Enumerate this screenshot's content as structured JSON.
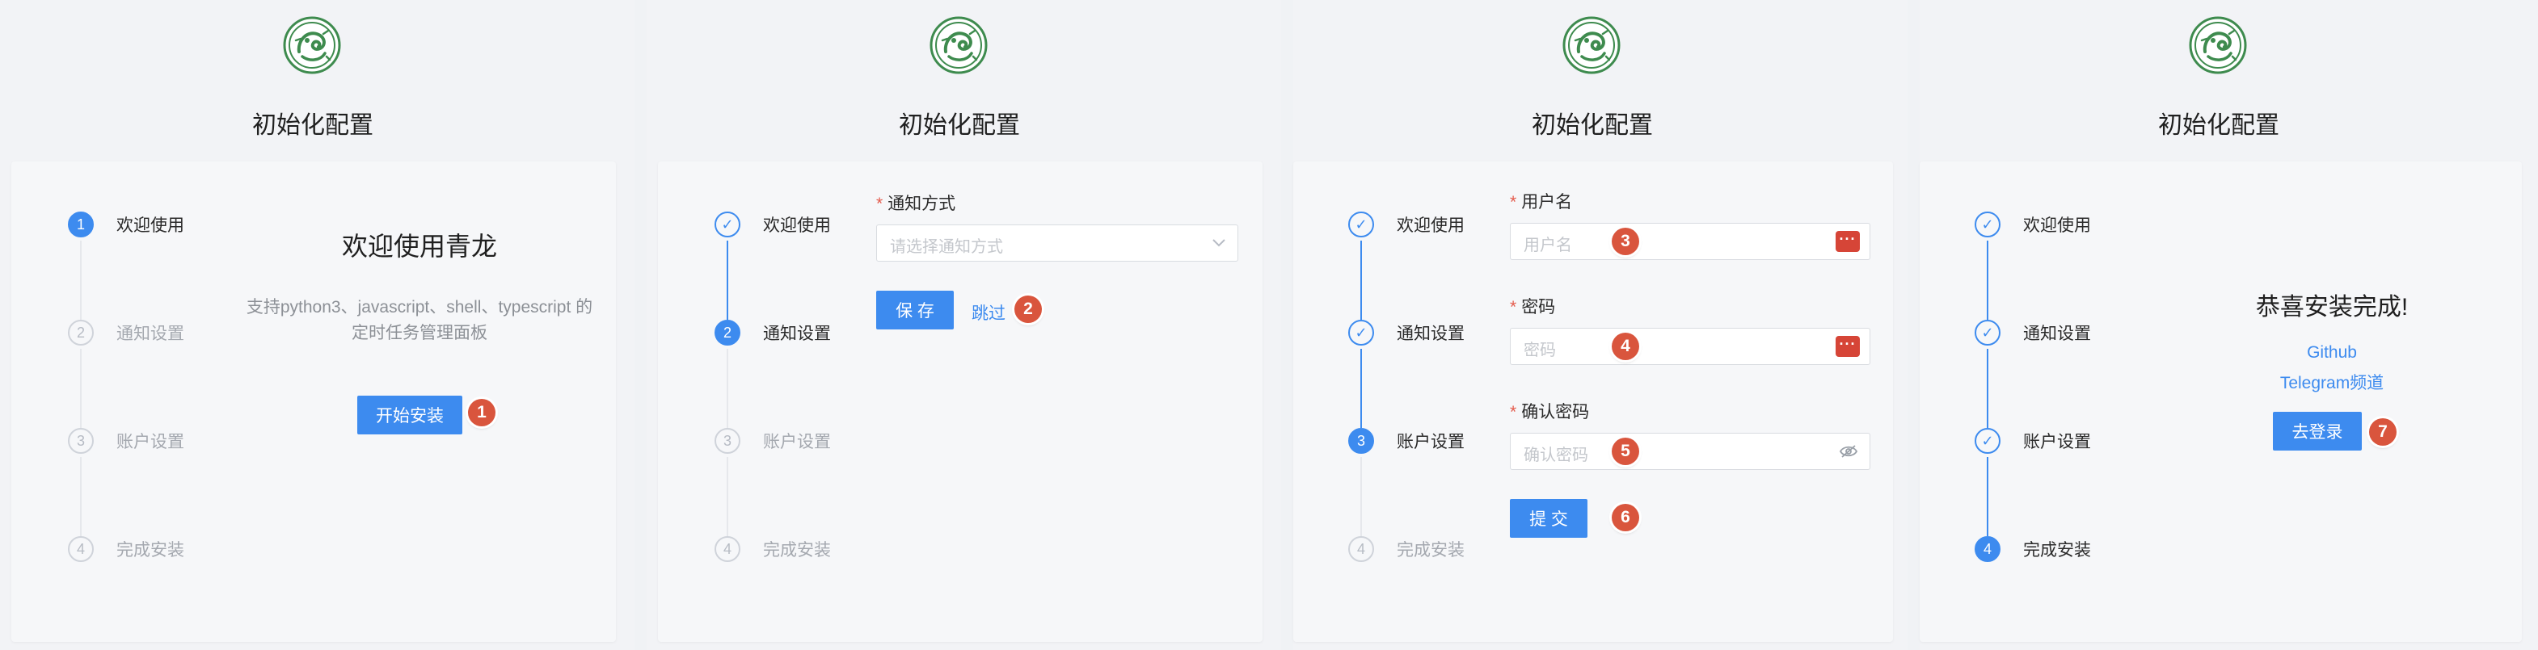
{
  "app": {
    "title": "初始化配置",
    "accent_color": "#3d8bef",
    "badge_color": "#d9553d",
    "logo_icon": "qinglong-dragon-logo"
  },
  "steps": [
    "欢迎使用",
    "通知设置",
    "账户设置",
    "完成安装"
  ],
  "step_numbers": [
    "1",
    "2",
    "3",
    "4"
  ],
  "done_icon": "✓",
  "panels": [
    {
      "welcome": {
        "heading": "欢迎使用青龙",
        "desc_line1": "支持python3、javascript、shell、typescript 的",
        "desc_line2": "定时任务管理面板",
        "start_button": "开始安装",
        "badge": "1"
      }
    },
    {
      "notify": {
        "label": "通知方式",
        "required_mark": "*",
        "placeholder": "请选择通知方式",
        "save_button": "保 存",
        "skip_link": "跳过",
        "badge": "2"
      }
    },
    {
      "account": {
        "username_label": "用户名",
        "username_placeholder": "用户名",
        "password_label": "密码",
        "password_placeholder": "密码",
        "confirm_label": "确认密码",
        "confirm_placeholder": "确认密码",
        "submit_button": "提 交",
        "badges": [
          "3",
          "4",
          "5",
          "6"
        ]
      }
    },
    {
      "done": {
        "heading": "恭喜安装完成!",
        "github_link": "Github",
        "telegram_link": "Telegram频道",
        "login_button": "去登录",
        "badge": "7"
      }
    }
  ]
}
